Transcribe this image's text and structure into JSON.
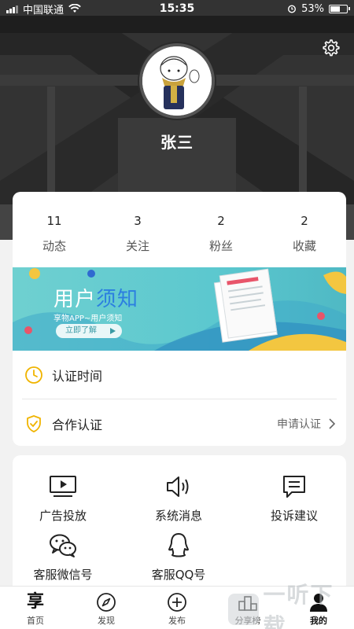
{
  "status_bar": {
    "carrier": "中国联通",
    "time": "15:35",
    "battery_percent_label": "53%",
    "battery_level": 0.53
  },
  "profile": {
    "name": "张三"
  },
  "stats": [
    {
      "count": "11",
      "label": "动态"
    },
    {
      "count": "3",
      "label": "关注"
    },
    {
      "count": "2",
      "label": "粉丝"
    },
    {
      "count": "2",
      "label": "收藏"
    }
  ],
  "banner": {
    "title_part1": "用户",
    "title_part2": "须知",
    "subtitle": "享物APP~用户须知",
    "button_label": "立即了解"
  },
  "list": {
    "certification_time": "认证时间",
    "cooperation": "合作认证",
    "cooperation_action": "申请认证"
  },
  "services": [
    {
      "label": "广告投放",
      "icon": "play-screen-icon"
    },
    {
      "label": "系统消息",
      "icon": "speaker-icon"
    },
    {
      "label": "投诉建议",
      "icon": "message-icon"
    },
    {
      "label": "客服微信号",
      "icon": "wechat-icon"
    },
    {
      "label": "客服QQ号",
      "icon": "qq-icon"
    }
  ],
  "tabbar": {
    "logo_glyph": "享",
    "tabs": [
      {
        "label": "首页"
      },
      {
        "label": "发现"
      },
      {
        "label": "发布"
      },
      {
        "label": "分享榜"
      },
      {
        "label": "我的"
      }
    ]
  },
  "watermark": {
    "text": "一听下载"
  },
  "colors": {
    "accent_yellow": "#f0b400",
    "banner_teal": "#5cc8cf",
    "banner_highlight": "#2c7fe0"
  }
}
